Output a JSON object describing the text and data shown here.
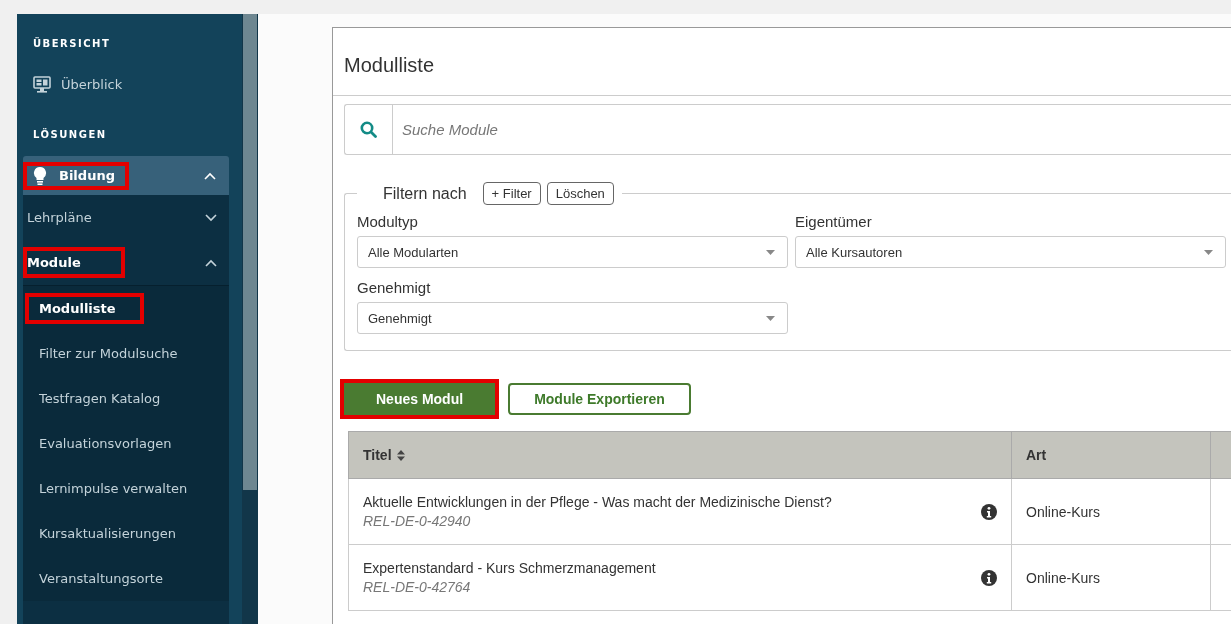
{
  "sidebar": {
    "sections": [
      {
        "heading": "ÜBERSICHT",
        "items": [
          {
            "label": "Überblick",
            "selected": false
          }
        ]
      },
      {
        "heading": "LÖSUNGEN"
      }
    ],
    "menu": {
      "label": "Bildung",
      "expanded": true,
      "highlighted": true,
      "children": [
        {
          "label": "Lehrpläne",
          "expanded": false,
          "highlighted": false
        },
        {
          "label": "Module",
          "expanded": true,
          "highlighted": true,
          "children": [
            {
              "label": "Modulliste",
              "selected": true,
              "highlighted": true
            },
            {
              "label": "Filter zur Modulsuche",
              "selected": false,
              "highlighted": false
            },
            {
              "label": "Testfragen Katalog",
              "selected": false,
              "highlighted": false
            },
            {
              "label": "Evaluationsvorlagen",
              "selected": false,
              "highlighted": false
            },
            {
              "label": "Lernimpulse verwalten",
              "selected": false,
              "highlighted": false
            },
            {
              "label": "Kursaktualisierungen",
              "selected": false,
              "highlighted": false
            },
            {
              "label": "Veranstaltungsorte",
              "selected": false,
              "highlighted": false
            }
          ]
        }
      ]
    }
  },
  "page": {
    "title": "Modulliste",
    "search": {
      "placeholder": "Suche Module"
    },
    "filter": {
      "legend": "Filtern nach",
      "buttons": [
        "+ Filter",
        "Löschen"
      ],
      "fields": [
        {
          "label": "Modultyp",
          "value": "Alle Modularten"
        },
        {
          "label": "Eigentümer",
          "value": "Alle Kursautoren"
        },
        {
          "label": "Genehmigt",
          "value": "Genehmigt"
        }
      ]
    },
    "actions": [
      {
        "label": "Neues Modul",
        "kind": "primary",
        "highlighted": true
      },
      {
        "label": "Module Exportieren",
        "kind": "outline",
        "highlighted": false
      }
    ],
    "table": {
      "columns": [
        {
          "label": "Titel",
          "sortable": true
        },
        {
          "label": "Art",
          "sortable": false
        }
      ],
      "rows": [
        {
          "title": "Aktuelle Entwicklungen in der Pflege - Was macht der Medizinische Dienst?",
          "code": "REL-DE-0-42940",
          "type": "Online-Kurs"
        },
        {
          "title": "Expertenstandard - Kurs Schmerzmanagement",
          "code": "REL-DE-0-42764",
          "type": "Online-Kurs"
        }
      ]
    }
  }
}
